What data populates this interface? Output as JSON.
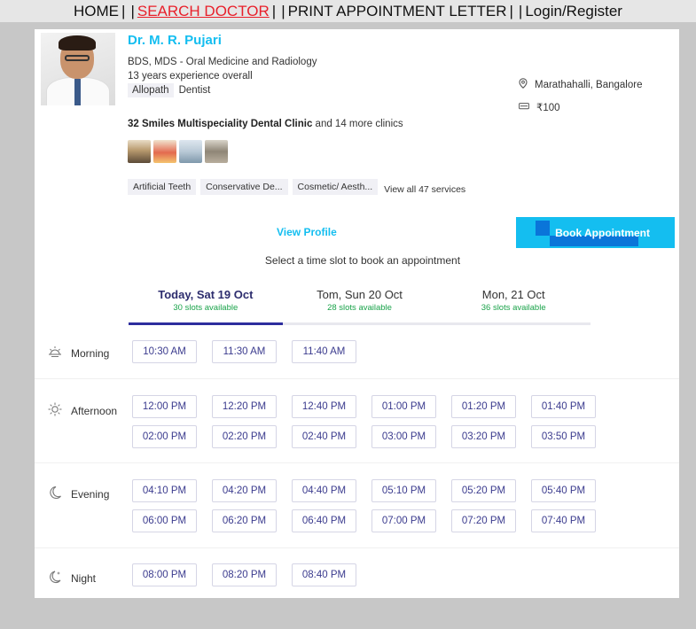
{
  "nav": {
    "home": "HOME",
    "search": "SEARCH DOCTOR",
    "print": "PRINT APPOINTMENT LETTER",
    "login": "Login/Register"
  },
  "doctor": {
    "name": "Dr. M. R. Pujari",
    "qualifications": "BDS, MDS - Oral Medicine and Radiology",
    "experience": "13 years experience overall",
    "system": "Allopath",
    "specialty": "Dentist",
    "location": "Marathahalli, Bangalore",
    "fee": "₹100",
    "clinic_name": "32 Smiles Multispeciality Dental Clinic",
    "clinic_more": " and 14 more clinics",
    "services": [
      "Artificial Teeth",
      "Conservative De...",
      "Cosmetic/ Aesth..."
    ],
    "services_more": "View all 47 services"
  },
  "actions": {
    "view_profile": "View Profile",
    "book": "Book Appointment",
    "select_note": "Select a time slot to book an appointment"
  },
  "days": [
    {
      "label": "Today, Sat 19 Oct",
      "slots": "30 slots available"
    },
    {
      "label": "Tom, Sun 20 Oct",
      "slots": "28 slots available"
    },
    {
      "label": "Mon, 21 Oct",
      "slots": "36 slots available"
    }
  ],
  "sections": {
    "morning": {
      "label": "Morning",
      "icon": "sunrise-icon",
      "slots": [
        "10:30 AM",
        "11:30 AM",
        "11:40 AM"
      ]
    },
    "afternoon": {
      "label": "Afternoon",
      "icon": "sun-icon",
      "slots": [
        "12:00 PM",
        "12:20 PM",
        "12:40 PM",
        "01:00 PM",
        "01:20 PM",
        "01:40 PM",
        "02:00 PM",
        "02:20 PM",
        "02:40 PM",
        "03:00 PM",
        "03:20 PM",
        "03:50 PM"
      ]
    },
    "evening": {
      "label": "Evening",
      "icon": "moon-icon",
      "slots": [
        "04:10 PM",
        "04:20 PM",
        "04:40 PM",
        "05:10 PM",
        "05:20 PM",
        "05:40 PM",
        "06:00 PM",
        "06:20 PM",
        "06:40 PM",
        "07:00 PM",
        "07:20 PM",
        "07:40 PM"
      ]
    },
    "night": {
      "label": "Night",
      "icon": "moon-stars-icon",
      "slots": [
        "08:00 PM",
        "08:20 PM",
        "08:40 PM"
      ]
    }
  },
  "colors": {
    "accent": "#14bef0",
    "nav_active": "#e8202b",
    "slot_text": "#3b3b8e",
    "available": "#1aa34a"
  }
}
